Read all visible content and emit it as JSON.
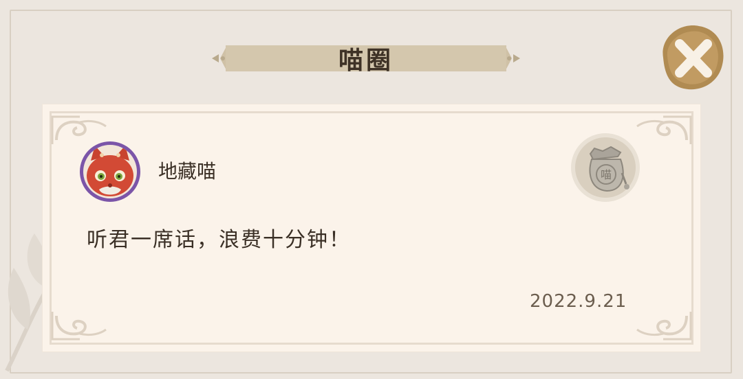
{
  "header": {
    "title": "喵圈"
  },
  "close_button": {
    "icon": "close-icon",
    "color": "#b08b52"
  },
  "post": {
    "username": "地藏喵",
    "avatar_icon": "red-cat-avatar-icon",
    "message": "听君一席话，浪费十分钟！",
    "date": "2022.9.21",
    "badge_icon": "coin-pouch-icon",
    "badge_glyph": "喵"
  },
  "colors": {
    "background": "#ece6df",
    "card": "#fbf3ea",
    "banner": "#cfc1a6",
    "text": "#3a2f25",
    "avatar_ring": "#7b55a8"
  }
}
